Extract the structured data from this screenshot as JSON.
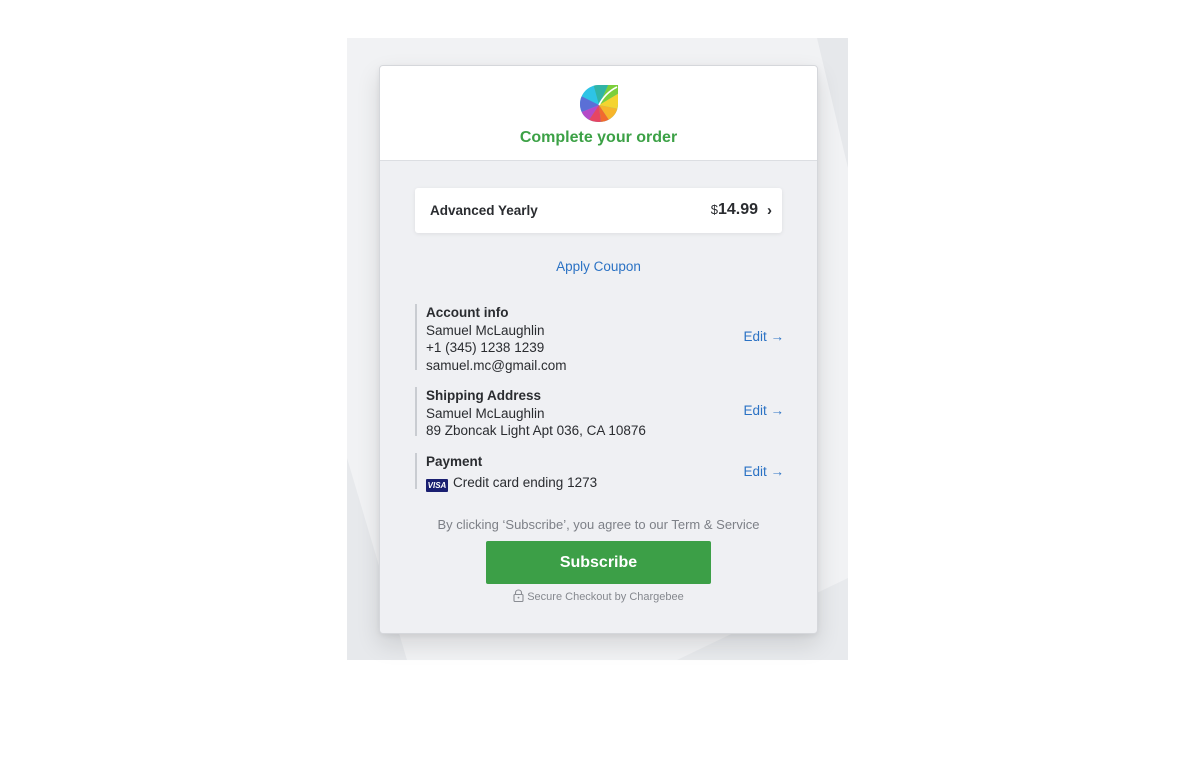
{
  "header": {
    "title": "Complete your order"
  },
  "plan": {
    "name": "Advanced Yearly",
    "currency": "$",
    "amount": "14.99",
    "chevron": "›"
  },
  "coupon": {
    "label": "Apply Coupon"
  },
  "account": {
    "title": "Account info",
    "name": "Samuel McLaughlin",
    "phone": "+1 (345) 1238 1239",
    "email": "samuel.mc@gmail.com",
    "edit_label": "Edit →"
  },
  "shipping": {
    "title": "Shipping Address",
    "name": "Samuel McLaughlin",
    "address": "89 Zboncak Light Apt 036, CA 10876",
    "edit_label": "Edit →"
  },
  "payment": {
    "title": "Payment",
    "card_brand": "VISA",
    "card_text": "Credit card ending 1273",
    "edit_label": "Edit →"
  },
  "terms": {
    "text": "By clicking ‘Subscribe’, you agree to our Term & Service"
  },
  "subscribe": {
    "label": "Subscribe"
  },
  "secure": {
    "text": "Secure Checkout by Chargebee"
  },
  "colors": {
    "accent_green": "#3c9f47",
    "link_blue": "#2b72c4",
    "card_bg": "#eff0f3"
  },
  "icons": {
    "logo": "chargebee-leaf-logo-icon",
    "lock": "lock-icon",
    "visa": "visa-card-icon"
  }
}
